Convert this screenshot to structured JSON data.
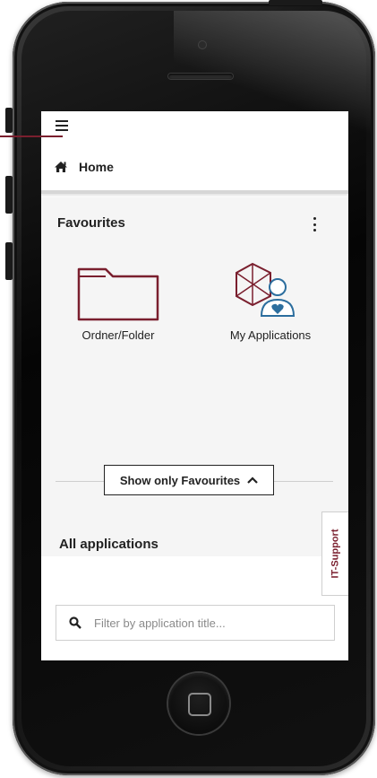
{
  "header": {
    "menu_icon": "hamburger-icon",
    "home_icon": "home-icon",
    "home_label": "Home"
  },
  "favourites": {
    "title": "Favourites",
    "menu_icon": "kebab-menu-icon",
    "tiles": [
      {
        "label": "Ordner/Folder",
        "icon": "folder-icon"
      },
      {
        "label": "My Applications",
        "icon": "my-applications-icon"
      }
    ],
    "toggle_label": "Show only Favourites",
    "toggle_icon": "chevron-up-icon"
  },
  "all_applications": {
    "title": "All applications"
  },
  "it_support": {
    "label": "IT-Support"
  },
  "filter": {
    "placeholder": "Filter by application title...",
    "value": "",
    "icon": "search-icon"
  },
  "colors": {
    "accent": "#7a1f2e",
    "icon_blue": "#2c6e9e"
  }
}
